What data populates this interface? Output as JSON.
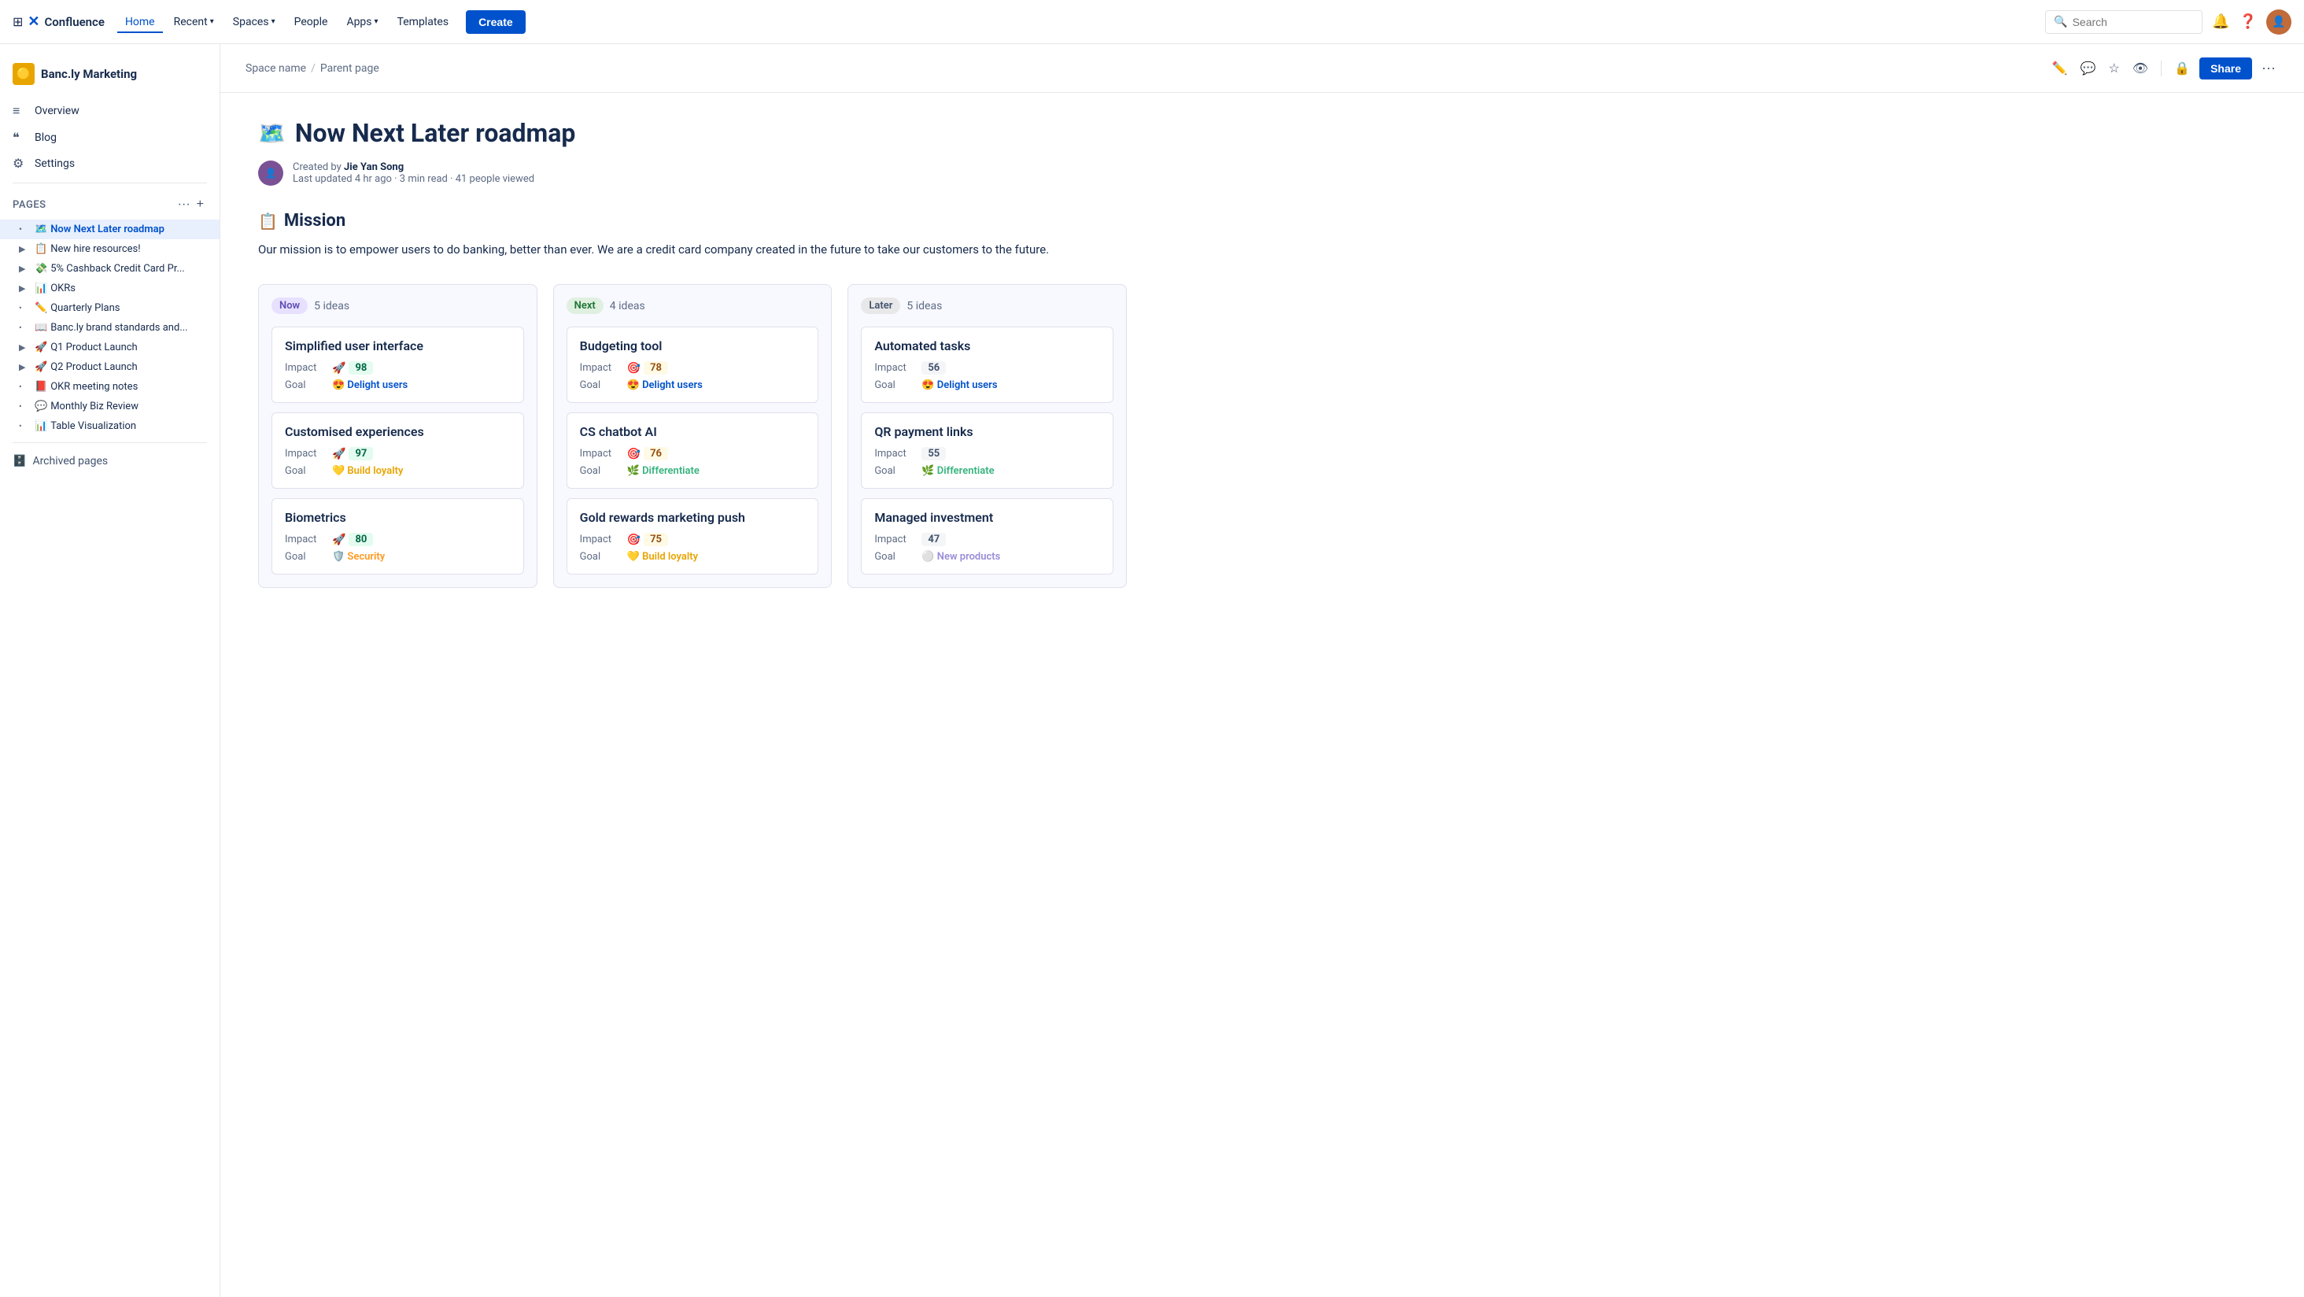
{
  "topnav": {
    "logo_text": "Confluence",
    "nav_items": [
      {
        "label": "Home",
        "active": true
      },
      {
        "label": "Recent",
        "dropdown": true
      },
      {
        "label": "Spaces",
        "dropdown": true
      },
      {
        "label": "People"
      },
      {
        "label": "Apps",
        "dropdown": true
      },
      {
        "label": "Templates"
      }
    ],
    "create_label": "Create",
    "search_placeholder": "Search"
  },
  "sidebar": {
    "space_name": "Banc.ly Marketing",
    "space_emoji": "🟡",
    "nav_items": [
      {
        "icon": "≡",
        "label": "Overview"
      },
      {
        "icon": "❝",
        "label": "Blog"
      },
      {
        "icon": "⚙",
        "label": "Settings"
      }
    ],
    "pages_label": "Pages",
    "pages": [
      {
        "emoji": "🗺️",
        "label": "Now Next Later roadmap",
        "active": true,
        "expandable": false
      },
      {
        "emoji": "📋",
        "label": "New hire resources!",
        "expandable": true
      },
      {
        "emoji": "💸",
        "label": "5% Cashback Credit Card Pr...",
        "expandable": true
      },
      {
        "emoji": "📊",
        "label": "OKRs",
        "expandable": true
      },
      {
        "emoji": "✏️",
        "label": "Quarterly Plans",
        "expandable": false
      },
      {
        "emoji": "📖",
        "label": "Banc.ly brand standards and...",
        "expandable": false
      },
      {
        "emoji": "🚀",
        "label": "Q1 Product Launch",
        "expandable": true
      },
      {
        "emoji": "🚀",
        "label": "Q2 Product Launch",
        "expandable": true
      },
      {
        "emoji": "📕",
        "label": "OKR meeting notes",
        "expandable": false
      },
      {
        "emoji": "💬",
        "label": "Monthly Biz Review",
        "expandable": false
      },
      {
        "emoji": "📊",
        "label": "Table Visualization",
        "expandable": false
      }
    ],
    "archived_label": "Archived pages"
  },
  "page_header": {
    "breadcrumb": [
      "Space name",
      "Parent page"
    ],
    "share_label": "Share"
  },
  "page": {
    "title_emoji": "🗺️",
    "title": "Now Next Later roadmap",
    "author": "Jie Yan Song",
    "meta": "Last updated 4 hr ago · 3 min read · 41 people viewed",
    "mission_emoji": "📋",
    "mission_title": "Mission",
    "mission_text": "Our mission is to empower users to do banking, better than ever. We are a credit card company created in the future to take our customers to the future."
  },
  "roadmap": {
    "columns": [
      {
        "id": "now",
        "label": "Now",
        "badge_class": "badge-now",
        "count": "5 ideas",
        "cards": [
          {
            "title": "Simplified user interface",
            "impact_emoji": "🚀",
            "impact": "98",
            "impact_badge_class": "badge-green",
            "goal_emoji": "😍",
            "goal_label": "Delight users",
            "goal_class": "goal-delight"
          },
          {
            "title": "Customised experiences",
            "impact_emoji": "🚀",
            "impact": "97",
            "impact_badge_class": "badge-green",
            "goal_emoji": "💛",
            "goal_label": "Build loyalty",
            "goal_class": "goal-loyalty"
          },
          {
            "title": "Biometrics",
            "impact_emoji": "🚀",
            "impact": "80",
            "impact_badge_class": "badge-green",
            "goal_emoji": "🛡️",
            "goal_label": "Security",
            "goal_class": "goal-security"
          }
        ]
      },
      {
        "id": "next",
        "label": "Next",
        "badge_class": "badge-next",
        "count": "4 ideas",
        "cards": [
          {
            "title": "Budgeting tool",
            "impact_emoji": "🎯",
            "impact": "78",
            "impact_badge_class": "badge-yellow",
            "goal_emoji": "😍",
            "goal_label": "Delight users",
            "goal_class": "goal-delight"
          },
          {
            "title": "CS chatbot AI",
            "impact_emoji": "🎯",
            "impact": "76",
            "impact_badge_class": "badge-yellow",
            "goal_emoji": "🌿",
            "goal_label": "Differentiate",
            "goal_class": "goal-differentiate"
          },
          {
            "title": "Gold rewards marketing push",
            "impact_emoji": "🎯",
            "impact": "75",
            "impact_badge_class": "badge-yellow",
            "goal_emoji": "💛",
            "goal_label": "Build loyalty",
            "goal_class": "goal-loyalty"
          }
        ]
      },
      {
        "id": "later",
        "label": "Later",
        "badge_class": "badge-later",
        "count": "5 ideas",
        "cards": [
          {
            "title": "Automated tasks",
            "impact_emoji": "",
            "impact": "56",
            "impact_badge_class": "badge-gray",
            "goal_emoji": "😍",
            "goal_label": "Delight users",
            "goal_class": "goal-delight"
          },
          {
            "title": "QR payment links",
            "impact_emoji": "",
            "impact": "55",
            "impact_badge_class": "badge-gray",
            "goal_emoji": "🌿",
            "goal_label": "Differentiate",
            "goal_class": "goal-differentiate"
          },
          {
            "title": "Managed investment",
            "impact_emoji": "",
            "impact": "47",
            "impact_badge_class": "badge-gray",
            "goal_emoji": "⚪",
            "goal_label": "New products",
            "goal_class": "goal-new-products"
          }
        ]
      }
    ]
  },
  "labels": {
    "impact": "Impact",
    "goal": "Goal",
    "overview": "Overview",
    "blog": "Blog",
    "settings": "Settings",
    "pages": "Pages",
    "archived_pages": "Archived pages"
  }
}
